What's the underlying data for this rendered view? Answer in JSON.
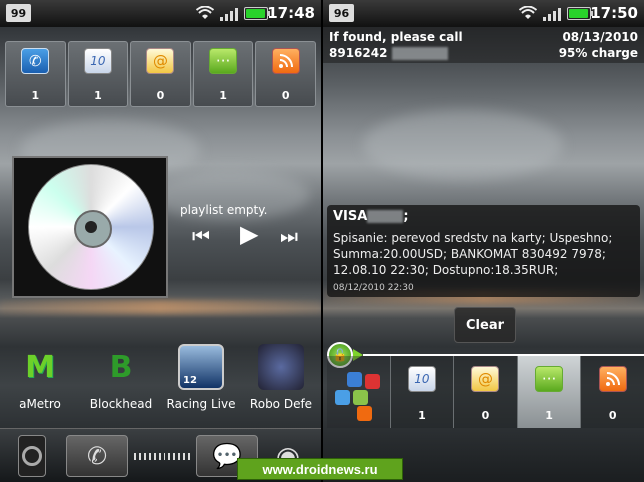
{
  "left": {
    "status": {
      "badge": "99",
      "time": "17:48"
    },
    "quick_panel": [
      {
        "icon": "phone-icon",
        "count": "1"
      },
      {
        "icon": "calendar-icon",
        "count": "1"
      },
      {
        "icon": "email-icon",
        "count": "0"
      },
      {
        "icon": "sms-icon",
        "count": "1"
      },
      {
        "icon": "rss-icon",
        "count": "0"
      }
    ],
    "music": {
      "status": "playlist empty."
    },
    "apps": [
      {
        "label": "aMetro"
      },
      {
        "label": "Blockhead"
      },
      {
        "label": "Racing Live",
        "badge": "12"
      },
      {
        "label": "Robo Defe"
      }
    ]
  },
  "right": {
    "status": {
      "badge": "96",
      "time": "17:50"
    },
    "owner": {
      "line1": "If found, please call",
      "line2": "8916242",
      "date": "08/13/2010",
      "charge": "95% charge"
    },
    "sms": {
      "from": "VISA",
      "from_suffix": ";",
      "body": "Spisanie: perevod sredstv na karty; Uspeshno; Summa:20.00USD; BANKOMAT 830492 7978; 12.08.10 22:30; Dostupno:18.35RUR;",
      "time": "08/12/2010 22:30"
    },
    "clear_label": "Clear",
    "quick_panel": [
      {
        "icon": "calendar-icon",
        "count": "1"
      },
      {
        "icon": "email-icon",
        "count": "0"
      },
      {
        "icon": "sms-icon",
        "count": "1"
      },
      {
        "icon": "rss-icon",
        "count": "0"
      }
    ]
  },
  "watermark": "www.droidnews.ru",
  "colors": {
    "accent_green": "#5fa31d",
    "battery_green": "#29d22b",
    "rss_orange": "#f06a10"
  }
}
